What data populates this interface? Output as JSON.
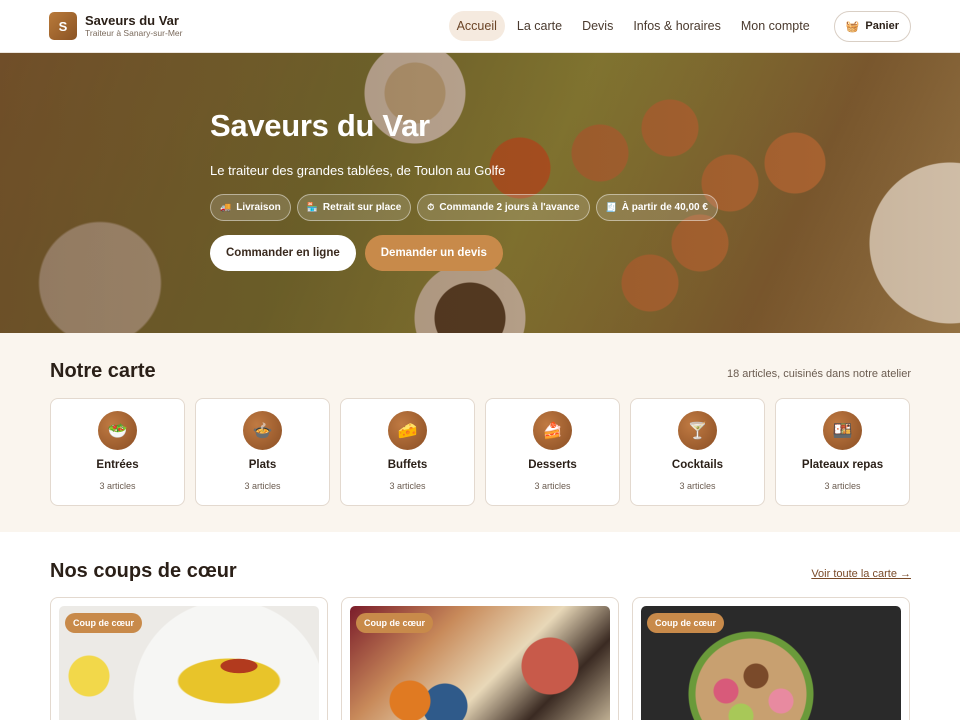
{
  "header": {
    "logo_letter": "S",
    "brand_name": "Saveurs du Var",
    "brand_tagline": "Traiteur à Sanary-sur-Mer",
    "nav": [
      {
        "label": "Accueil",
        "active": true
      },
      {
        "label": "La carte",
        "active": false
      },
      {
        "label": "Devis",
        "active": false
      },
      {
        "label": "Infos & horaires",
        "active": false
      },
      {
        "label": "Mon compte",
        "active": false
      }
    ],
    "cart_label": "Panier",
    "cart_icon": "basket-icon"
  },
  "hero": {
    "title": "Saveurs du Var",
    "subtitle": "Le traiteur des grandes tablées, de Toulon au Golfe",
    "chips": [
      {
        "icon": "truck-icon",
        "glyph": "🚚",
        "label": "Livraison"
      },
      {
        "icon": "store-icon",
        "glyph": "🏪",
        "label": "Retrait sur place"
      },
      {
        "icon": "clock-icon",
        "glyph": "⏱",
        "label": "Commande 2 jours à l'avance"
      },
      {
        "icon": "receipt-icon",
        "glyph": "🧾",
        "label": "À partir de 40,00 €"
      }
    ],
    "primary_button": "Commander en ligne",
    "secondary_button": "Demander un devis"
  },
  "carte": {
    "title": "Notre carte",
    "meta": "18 articles, cuisinés dans notre atelier",
    "categories": [
      {
        "name": "Entrées",
        "count": "3 articles",
        "icon": "salad-icon",
        "glyph": "🥗"
      },
      {
        "name": "Plats",
        "count": "3 articles",
        "icon": "stew-icon",
        "glyph": "🍲"
      },
      {
        "name": "Buffets",
        "count": "3 articles",
        "icon": "cheese-icon",
        "glyph": "🧀"
      },
      {
        "name": "Desserts",
        "count": "3 articles",
        "icon": "cake-icon",
        "glyph": "🍰"
      },
      {
        "name": "Cocktails",
        "count": "3 articles",
        "icon": "cocktail-icon",
        "glyph": "🍸"
      },
      {
        "name": "Plateaux repas",
        "count": "3 articles",
        "icon": "bento-icon",
        "glyph": "🍱"
      }
    ]
  },
  "coeur": {
    "title": "Nos coups de cœur",
    "see_all": "Voir toute la carte →",
    "cards": [
      {
        "badge": "Coup de cœur"
      },
      {
        "badge": "Coup de cœur"
      },
      {
        "badge": "Coup de cœur"
      }
    ]
  }
}
